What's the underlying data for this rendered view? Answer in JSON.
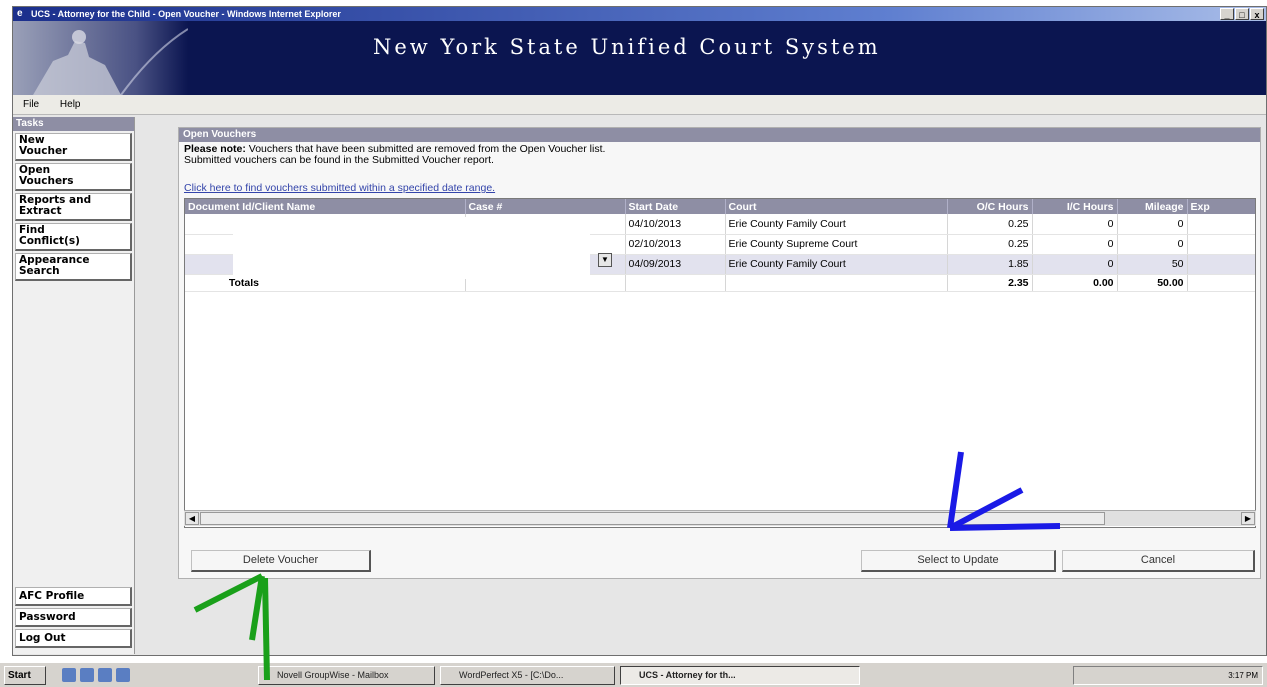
{
  "window": {
    "title": "UCS - Attorney for the Child - Open Voucher - Windows Internet Explorer",
    "controls": [
      "_",
      "□",
      "x"
    ]
  },
  "banner": {
    "title": "New York State Unified Court System"
  },
  "menu": [
    "File",
    "Help"
  ],
  "sidebar": {
    "header": "Tasks",
    "items": [
      {
        "line1": "New",
        "line2": "Voucher"
      },
      {
        "line1": "Open",
        "line2": "Vouchers"
      },
      {
        "line1": "Reports and",
        "line2": "Extract"
      },
      {
        "line1": "Find",
        "line2": "Conflict(s)"
      },
      {
        "line1": "Appearance",
        "line2": "Search"
      }
    ],
    "bottom": [
      "AFC Profile",
      "Password",
      "Log Out"
    ]
  },
  "panel": {
    "header": "Open Vouchers",
    "note_bold": "Please note:",
    "note_line1": "Vouchers that have been submitted are removed from the Open Voucher list.",
    "note_line2": "Submitted vouchers can be found in the Submitted Voucher report.",
    "link": "Click here to find vouchers submitted within a specified date range."
  },
  "grid": {
    "columns": [
      "Document Id/Client Name",
      "Case #",
      "Start Date",
      "Court",
      "O/C Hours",
      "I/C Hours",
      "Mileage",
      "Exp"
    ],
    "rows": [
      {
        "start_date": "04/10/2013",
        "court": "Erie County Family Court",
        "oc_hours": "0.25",
        "ic_hours": "0",
        "mileage": "0"
      },
      {
        "start_date": "02/10/2013",
        "court": "Erie County Supreme Court",
        "oc_hours": "0.25",
        "ic_hours": "0",
        "mileage": "0"
      },
      {
        "start_date": "04/09/2013",
        "court": "Erie County Family Court",
        "oc_hours": "1.85",
        "ic_hours": "0",
        "mileage": "50"
      }
    ],
    "totals": {
      "label": "Totals",
      "oc_hours": "2.35",
      "ic_hours": "0.00",
      "mileage": "50.00"
    }
  },
  "buttons": {
    "delete": "Delete Voucher",
    "select": "Select to Update",
    "cancel": "Cancel"
  },
  "taskbar": {
    "start": "Start",
    "tasks": [
      "Novell GroupWise - Mailbox",
      "WordPerfect X5 - [C:\\Do...",
      "UCS - Attorney for th..."
    ],
    "clock": "3:17 PM"
  },
  "annotations": {
    "green_arrow_color": "#1aa01a",
    "blue_arrow_color": "#1a1ae6"
  }
}
